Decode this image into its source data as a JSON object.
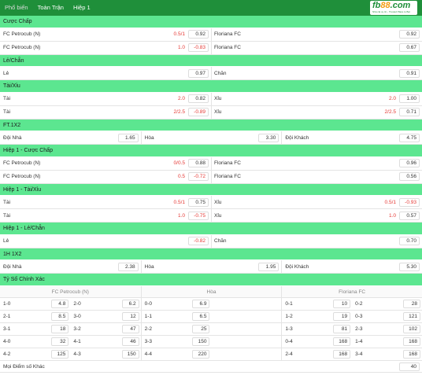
{
  "topbar": {
    "tabs": [
      "Phổ biến",
      "Toàn Trận",
      "Hiệp 1"
    ],
    "logo_text_a": "fb",
    "logo_text_b": "88",
    "logo_text_c": ".com",
    "logo_tagline": "Nhà cái uy tín - Trusted Place to Bet"
  },
  "colors": {
    "header_green": "#1f8f3a",
    "section_green": "#5ce690",
    "negative_red": "#e53935"
  },
  "sections": {
    "handicap": {
      "title": "Cược Chấp",
      "rows": [
        {
          "home": "FC Petrocub (N)",
          "home_hc": "0.5/1",
          "home_odds": "0.92",
          "away": "Floriana FC",
          "away_hc": "",
          "away_odds": "0.92"
        },
        {
          "home": "FC Petrocub (N)",
          "home_hc": "1.0",
          "home_odds": "-0.83",
          "away": "Floriana FC",
          "away_hc": "",
          "away_odds": "0.67"
        }
      ]
    },
    "oddeven": {
      "title": "Lẻ/Chẵn",
      "rows": [
        {
          "home": "Lẻ",
          "home_hc": "",
          "home_odds": "0.97",
          "away": "Chẵn",
          "away_hc": "",
          "away_odds": "0.91"
        }
      ]
    },
    "overunder": {
      "title": "Tài/Xỉu",
      "rows": [
        {
          "home": "Tài",
          "home_hc": "2.0",
          "home_odds": "0.82",
          "away": "Xỉu",
          "away_hc": "2.0",
          "away_odds": "1.00"
        },
        {
          "home": "Tài",
          "home_hc": "2/2.5",
          "home_odds": "-0.89",
          "away": "Xỉu",
          "away_hc": "2/2.5",
          "away_odds": "0.71"
        }
      ]
    },
    "ft1x2": {
      "title": "FT.1X2",
      "home": "Đội Nhà",
      "home_odds": "1.65",
      "draw": "Hòa",
      "draw_odds": "3.30",
      "away": "Đội Khách",
      "away_odds": "4.75"
    },
    "h1_handicap": {
      "title": "Hiệp 1 - Cược Chấp",
      "rows": [
        {
          "home": "FC Petrocub (N)",
          "home_hc": "0/0.5",
          "home_odds": "0.88",
          "away": "Floriana FC",
          "away_hc": "",
          "away_odds": "0.96"
        },
        {
          "home": "FC Petrocub (N)",
          "home_hc": "0.5",
          "home_odds": "-0.72",
          "away": "Floriana FC",
          "away_hc": "",
          "away_odds": "0.56"
        }
      ]
    },
    "h1_overunder": {
      "title": "Hiệp 1 - Tài/Xỉu",
      "rows": [
        {
          "home": "Tài",
          "home_hc": "0.5/1",
          "home_odds": "0.75",
          "away": "Xỉu",
          "away_hc": "0.5/1",
          "away_odds": "-0.93"
        },
        {
          "home": "Tài",
          "home_hc": "1.0",
          "home_odds": "-0.75",
          "away": "Xỉu",
          "away_hc": "1.0",
          "away_odds": "0.57"
        }
      ]
    },
    "h1_oddeven": {
      "title": "Hiệp 1 - Lẻ/Chẵn",
      "rows": [
        {
          "home": "Lẻ",
          "home_hc": "",
          "home_odds": "-0.82",
          "away": "Chẵn",
          "away_hc": "",
          "away_odds": "0.70"
        }
      ]
    },
    "h1_1x2": {
      "title": "1H 1X2",
      "home": "Đội Nhà",
      "home_odds": "2.38",
      "draw": "Hòa",
      "draw_odds": "1.95",
      "away": "Đội Khách",
      "away_odds": "5.30"
    },
    "correct_score": {
      "title": "Tỷ Số Chính Xác",
      "col_headers": [
        "FC Petrocub (N)",
        "Hòa",
        "Floriana FC"
      ],
      "rows": [
        [
          [
            "1-0",
            "4.8"
          ],
          [
            "2-0",
            "6.2"
          ],
          [
            "0-0",
            "6.9"
          ],
          [
            "0-1",
            "10"
          ],
          [
            "0-2",
            "28"
          ]
        ],
        [
          [
            "2-1",
            "8.5"
          ],
          [
            "3-0",
            "12"
          ],
          [
            "1-1",
            "6.5"
          ],
          [
            "1-2",
            "19"
          ],
          [
            "0-3",
            "121"
          ]
        ],
        [
          [
            "3-1",
            "18"
          ],
          [
            "3-2",
            "47"
          ],
          [
            "2-2",
            "25"
          ],
          [
            "1-3",
            "81"
          ],
          [
            "2-3",
            "102"
          ]
        ],
        [
          [
            "4-0",
            "32"
          ],
          [
            "4-1",
            "46"
          ],
          [
            "3-3",
            "150"
          ],
          [
            "0-4",
            "168"
          ],
          [
            "1-4",
            "168"
          ]
        ],
        [
          [
            "4-2",
            "125"
          ],
          [
            "4-3",
            "150"
          ],
          [
            "4-4",
            "220"
          ],
          [
            "2-4",
            "168"
          ],
          [
            "3-4",
            "168"
          ]
        ]
      ],
      "other_label": "Mọi Điểm số Khác",
      "other_odds": "40"
    }
  }
}
